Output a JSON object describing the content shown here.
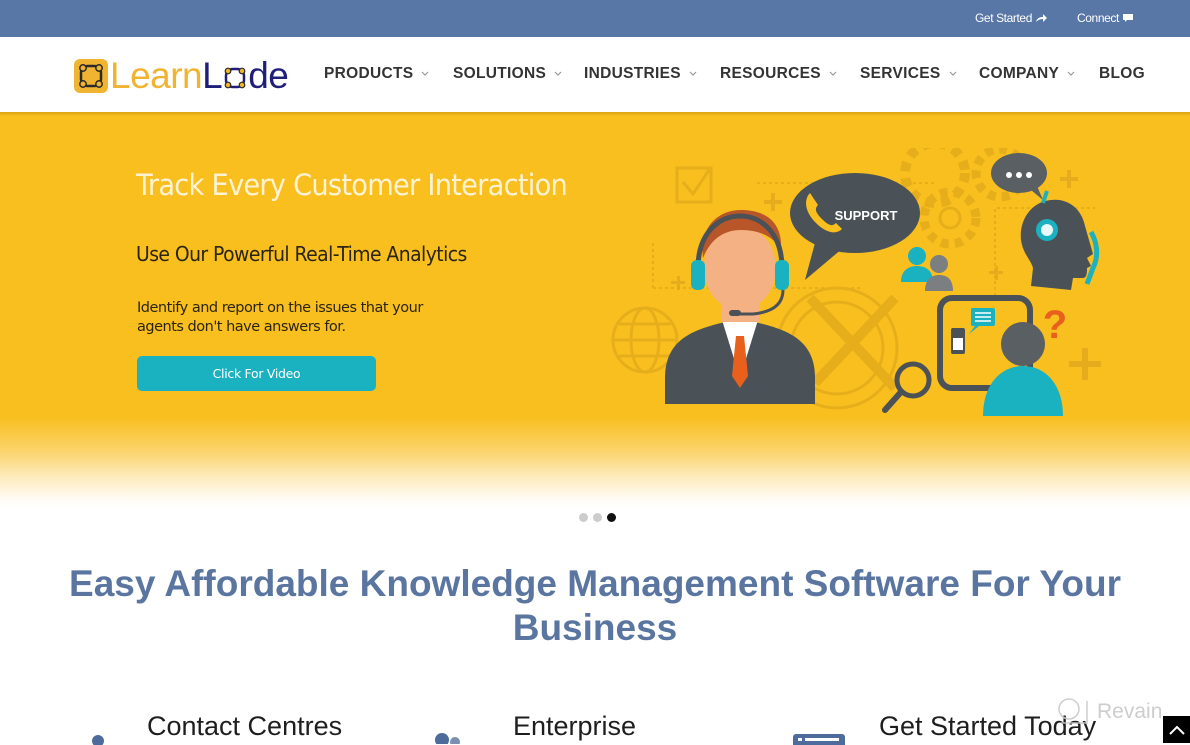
{
  "topbar": {
    "get_started_label": "Get Started",
    "get_started_icon": "share-arrow-icon",
    "connect_label": "Connect",
    "connect_icon": "chat-bubble-icon"
  },
  "brand": {
    "name_part1": "Learn",
    "name_part2_l": "L",
    "name_part2_rest": "de",
    "colors": {
      "primary": "#f0b431",
      "secondary": "#1f1f7a"
    }
  },
  "nav": {
    "items": [
      {
        "label": "PRODUCTS",
        "has_dropdown": true
      },
      {
        "label": "SOLUTIONS",
        "has_dropdown": true
      },
      {
        "label": "INDUSTRIES",
        "has_dropdown": true
      },
      {
        "label": "RESOURCES",
        "has_dropdown": true
      },
      {
        "label": "SERVICES",
        "has_dropdown": true
      },
      {
        "label": "COMPANY",
        "has_dropdown": true
      },
      {
        "label": "BLOG",
        "has_dropdown": false
      }
    ]
  },
  "hero": {
    "title": "Track Every Customer Interaction",
    "subtitle": "Use Our Powerful Real-Time Analytics",
    "body": "Identify and report on the issues that your agents don't have answers for.",
    "button_label": "Click For Video",
    "illustration_bubble_text": "SUPPORT",
    "colors": {
      "background": "#f9bf1f",
      "button": "#1ab1c1",
      "illustration_dark": "#4a5157",
      "illustration_teal": "#1ab1c1",
      "accent_orange": "#e8601c"
    }
  },
  "carousel": {
    "slide_count": 3,
    "active_index": 2
  },
  "section": {
    "headline": "Easy Affordable Knowledge Management Software For Your Business",
    "color": "#5a76a0"
  },
  "features": [
    {
      "label": "Contact Centres",
      "icon": "people-icon"
    },
    {
      "label": "Enterprise",
      "icon": "team-icon"
    },
    {
      "label": "Get Started Today",
      "icon": "browser-window-icon"
    }
  ],
  "watermark": {
    "label": "Revain"
  },
  "back_to_top": {
    "icon": "chevron-up-icon"
  }
}
